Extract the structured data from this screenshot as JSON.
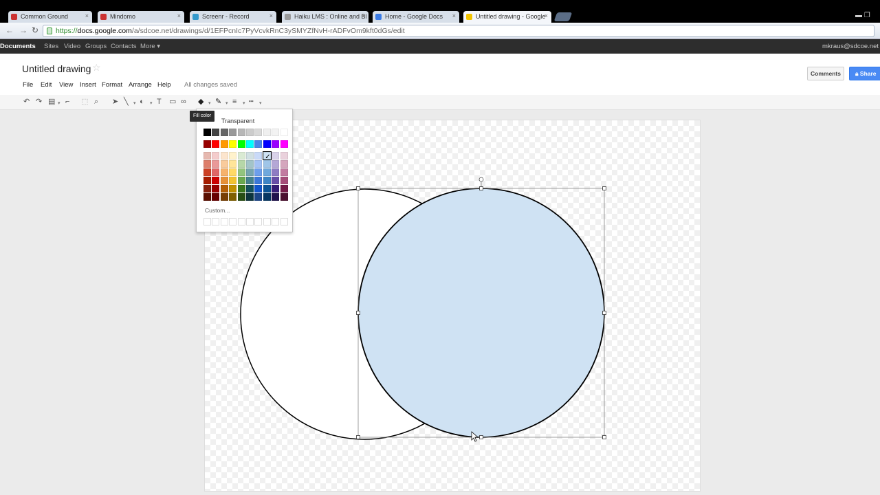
{
  "browser": {
    "tabs": [
      {
        "label": "Common Ground",
        "favicon": "#c33"
      },
      {
        "label": "Mindomo",
        "favicon": "#c33"
      },
      {
        "label": "Screenr - Record",
        "favicon": "#39c"
      },
      {
        "label": "Haiku LMS : Online and Bl",
        "favicon": "#999"
      },
      {
        "label": "Home - Google Docs",
        "favicon": "#3a7be5"
      },
      {
        "label": "Untitled drawing - Google",
        "favicon": "#f2c400"
      }
    ],
    "url_scheme": "https://",
    "url_host": "docs.google.com",
    "url_path": "/a/sdcoe.net/drawings/d/1EFPcnIc7PyVcvkRnC3ySMYZfNvH-rADFvOm9kft0dGs/edit"
  },
  "gbar": {
    "items": [
      "Documents",
      "Sites",
      "Video",
      "Groups",
      "Contacts",
      "More ▾"
    ],
    "user": "mkraus@sdcoe.net"
  },
  "doc": {
    "title": "Untitled drawing",
    "menus": [
      "File",
      "Edit",
      "View",
      "Insert",
      "Format",
      "Arrange",
      "Help"
    ],
    "save_status": "All changes saved",
    "comments_label": "Comments",
    "share_label": "Share"
  },
  "fill_popup": {
    "tooltip": "Fill color",
    "transparent_label": "Transparent",
    "custom_label": "Custom...",
    "selected_color": "#cfe2f3"
  },
  "colors": {
    "accent": "#4a8af4",
    "circle_fill": "#cfe2f3",
    "stroke": "#000000"
  }
}
